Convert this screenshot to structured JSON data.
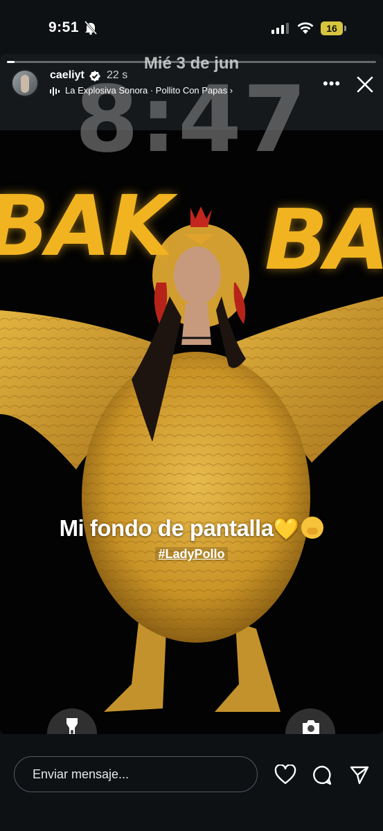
{
  "status_bar": {
    "time": "9:51",
    "battery_level": "16",
    "mute": true
  },
  "story": {
    "progress": 0.02,
    "header": {
      "username": "caeliyt",
      "verified": true,
      "time_ago": "22 s",
      "music": "La Explosiva Sonora · Pollito Con Papas",
      "music_chevron": "›",
      "more_label": "•••"
    },
    "wallpaper": {
      "date": "Mié 3 de jun",
      "clock": "8:47",
      "graffiti_left": "BAK",
      "graffiti_right": "BA"
    },
    "caption": {
      "text": "Mi fondo de pantalla",
      "heart_emoji": "💛",
      "hashtag": "#LadyPollo"
    }
  },
  "bottom_bar": {
    "message_placeholder": "Enviar mensaje...",
    "actions": [
      "heart-icon",
      "reply-icon",
      "share-icon"
    ]
  },
  "colors": {
    "background": "#0d1114",
    "feather_yellow": "#d8a93a",
    "graffiti_yellow": "#f1b320",
    "battery": "#d7c53f"
  }
}
